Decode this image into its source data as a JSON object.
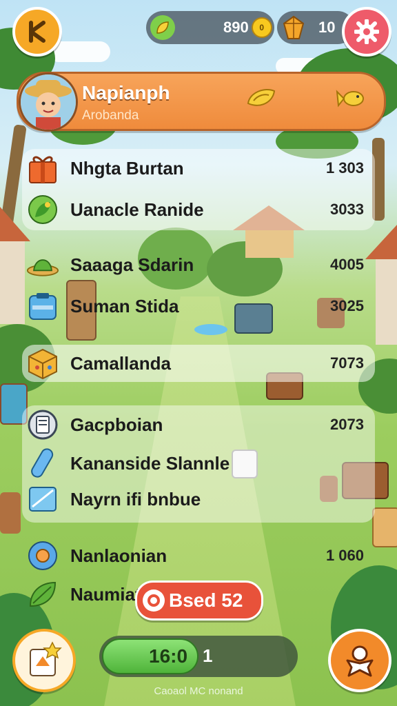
{
  "hud": {
    "coins_value": "890",
    "coins_badge": "0",
    "gems_value": "10"
  },
  "profile": {
    "name": "Napianph",
    "subtitle": "Arobanda"
  },
  "list": [
    {
      "label": "Nhgta Burtan",
      "value": "1 303",
      "icon": "gift-box-icon"
    },
    {
      "label": "Uanacle Ranide",
      "value": "3033",
      "icon": "leaf-badge-icon"
    },
    {
      "label": "Saaaga Sdarin",
      "value": "4005",
      "icon": "hat-icon"
    },
    {
      "label": "Suman Stida",
      "value": "3025",
      "icon": "jar-icon"
    },
    {
      "label": "Camallanda",
      "value": "7073",
      "icon": "crate-icon"
    },
    {
      "label": "Gacpboian",
      "value": "2073",
      "icon": "scroll-icon"
    },
    {
      "label": "Kananside Slannle",
      "value": "",
      "icon": "crystal-icon"
    },
    {
      "label": "Nayrn ifi bnbue",
      "value": "",
      "icon": "ice-block-icon"
    },
    {
      "label": "Nanlaonian",
      "value": "1 060",
      "icon": "ring-icon"
    },
    {
      "label": "Naumiat",
      "value": "",
      "icon": "herb-icon"
    }
  ],
  "badge": {
    "label": "Bsed 52"
  },
  "progress": {
    "label": "16:0",
    "count": "1",
    "fraction": 0.5
  },
  "footer": {
    "text": "Caoaol MC nonand"
  },
  "colors": {
    "accent_orange": "#f28a2a",
    "banner": "#ef8b3c",
    "progress_green": "#4fb43a",
    "settings_red": "#ee5b6a"
  }
}
